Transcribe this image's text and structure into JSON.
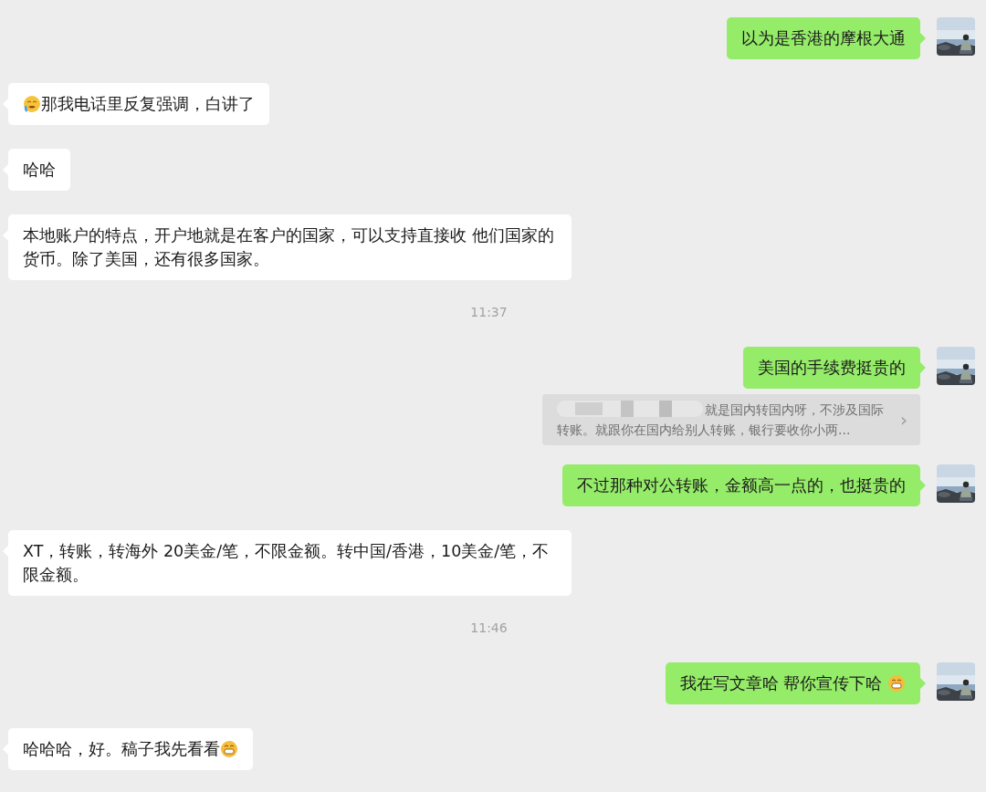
{
  "messages": [
    {
      "kind": "out",
      "text": "以为是香港的摩根大通"
    },
    {
      "kind": "in",
      "text": "那我电话里反复强调，白讲了",
      "lead_emoji": true
    },
    {
      "kind": "in",
      "text": "哈哈"
    },
    {
      "kind": "in",
      "text": "本地账户的特点，开户地就是在客户的国家，可以支持直接收 他们国家的货币。除了美国，还有很多国家。"
    },
    {
      "kind": "time",
      "text": "11:37"
    },
    {
      "kind": "out",
      "text": "美国的手续费挺贵的"
    },
    {
      "kind": "quote",
      "text": "就是国内转国内呀，不涉及国际转账。就跟你在国内给别人转账，银行要收你小两...",
      "arrow": "›"
    },
    {
      "kind": "out",
      "text": "不过那种对公转账，金额高一点的，也挺贵的"
    },
    {
      "kind": "in",
      "text": "XT，转账，转海外 20美金/笔，不限金额。转中国/香港，10美金/笔，不限金额。"
    },
    {
      "kind": "time",
      "text": "11:46"
    },
    {
      "kind": "out",
      "text": "我在写文章哈 帮你宣传下哈",
      "trail_emoji": true
    },
    {
      "kind": "in",
      "text": "哈哈哈，好。稿子我先看看",
      "trail_emoji": true
    }
  ]
}
